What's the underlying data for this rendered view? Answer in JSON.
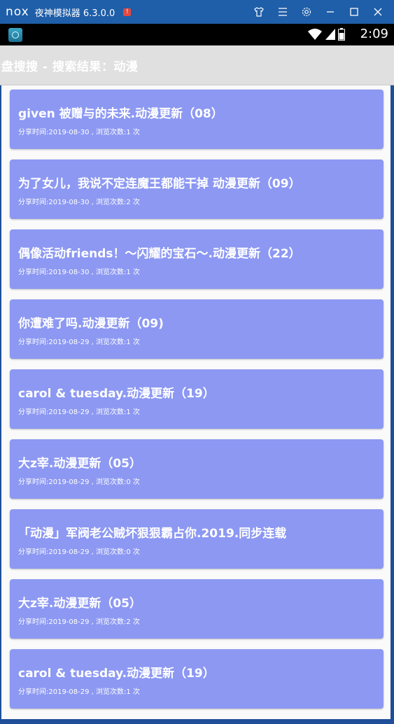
{
  "emulator": {
    "logo": "nox",
    "title": "夜神模拟器 6.3.0.0",
    "alert": "!"
  },
  "status_bar": {
    "time": "2:09"
  },
  "app_bar": {
    "title": "盘搜搜 - 搜索结果：动漫"
  },
  "results": [
    {
      "title": "given 被赠与的未来.动漫更新（08）",
      "meta": "分享时间:2019-08-30 , 浏览次数:1 次"
    },
    {
      "title": "为了女儿，我说不定连魔王都能干掉 动漫更新（09）",
      "meta": "分享时间:2019-08-30 , 浏览次数:2 次"
    },
    {
      "title": "偶像活动friends！～闪耀的宝石～.动漫更新（22）",
      "meta": "分享时间:2019-08-30 , 浏览次数:1 次"
    },
    {
      "title": "你遭难了吗.动漫更新（09)",
      "meta": "分享时间:2019-08-29 , 浏览次数:1 次"
    },
    {
      "title": "carol & tuesday.动漫更新（19）",
      "meta": "分享时间:2019-08-29 , 浏览次数:1 次"
    },
    {
      "title": "大z宰.动漫更新（05）",
      "meta": "分享时间:2019-08-29 , 浏览次数:0 次"
    },
    {
      "title": "「动漫」军阀老公贼坏狠狠霸占你.2019.同步连载",
      "meta": "分享时间:2019-08-29 , 浏览次数:0 次"
    },
    {
      "title": "大z宰.动漫更新（05）",
      "meta": "分享时间:2019-08-29 , 浏览次数:2 次"
    },
    {
      "title": "carol & tuesday.动漫更新（19）",
      "meta": "分享时间:2019-08-29 , 浏览次数:1 次"
    }
  ],
  "colors": {
    "card": "#8c98f2",
    "emulator_bar": "#1f5ea8",
    "app_bar": "#e0e0e0"
  },
  "icons": [
    "shirt-icon",
    "menu-icon",
    "gear-icon",
    "minimize-icon",
    "maximize-icon",
    "close-icon",
    "wifi-icon",
    "signal-icon",
    "battery-icon"
  ]
}
